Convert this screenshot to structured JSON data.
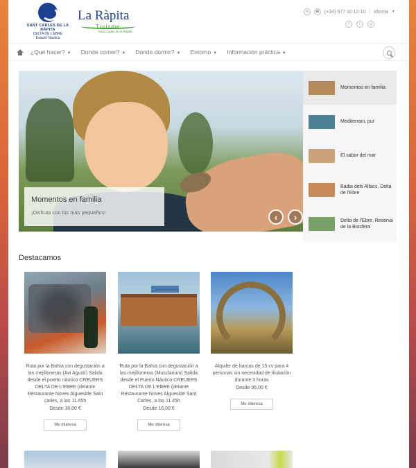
{
  "header": {
    "logo1": {
      "line1": "SANT CARLES DE LA RÀPITA",
      "line2": "DELTA DE L'EBRE",
      "line3": "Estació Nàutica"
    },
    "logo2": {
      "name": "La Ràpita",
      "tag": "Turisme",
      "sub": "Sant Carles de la Ràpita"
    },
    "phone": "(+34) 977 10 10 10",
    "language_label": "Idioma"
  },
  "nav": {
    "items": [
      {
        "label": "¿Qué hacer?"
      },
      {
        "label": "Donde comer?"
      },
      {
        "label": "Donde dormir?"
      },
      {
        "label": "Entorno"
      },
      {
        "label": "Información práctica"
      }
    ]
  },
  "hero": {
    "caption_title": "Momentos en familia",
    "caption_sub": "¡Disfruta con los más pequeños!"
  },
  "slides": [
    {
      "label": "Momentos en família",
      "color": "#b48a5a"
    },
    {
      "label": "Mediterrani, pur",
      "color": "#4b7f94"
    },
    {
      "label": "El sabor del mar",
      "color": "#c9a27a"
    },
    {
      "label": "Badia dels Alfacs, Delta de l'Ebre",
      "color": "#c98a5a"
    },
    {
      "label": "Delta de l'Ebre, Reserva de la Biosfera",
      "color": "#7aa06a"
    }
  ],
  "featured": {
    "title": "Destacamos",
    "cards": [
      {
        "desc": "Ruta por la Bahía con degustación a las mejilloneras (Avi Agustí) Salida desde el puerto náutico CREUERS DELTA DE L'EBRE (delante Restaurante Noves Algueside Sant carles, a las 11.45h",
        "price": "Desde 16,00 €",
        "button": "Me interesa"
      },
      {
        "desc": "Ruta por la Bahía con degustación a las mejilloneras (Musclarium) Salida desde el Puerto Náutico CREUERS DELTA DE L'EBRE (delante Restaurante Noves Algueside Sant Carles, a las 11.45h",
        "price": "Desde 16,00 €",
        "button": "Me interesa"
      },
      {
        "desc": "Alquiler de barcas de 15 cv para 4 personas sin necesidad de titulación durante 3 horas",
        "price": "Desde 95,00 €",
        "button": "Me interesa"
      }
    ]
  }
}
